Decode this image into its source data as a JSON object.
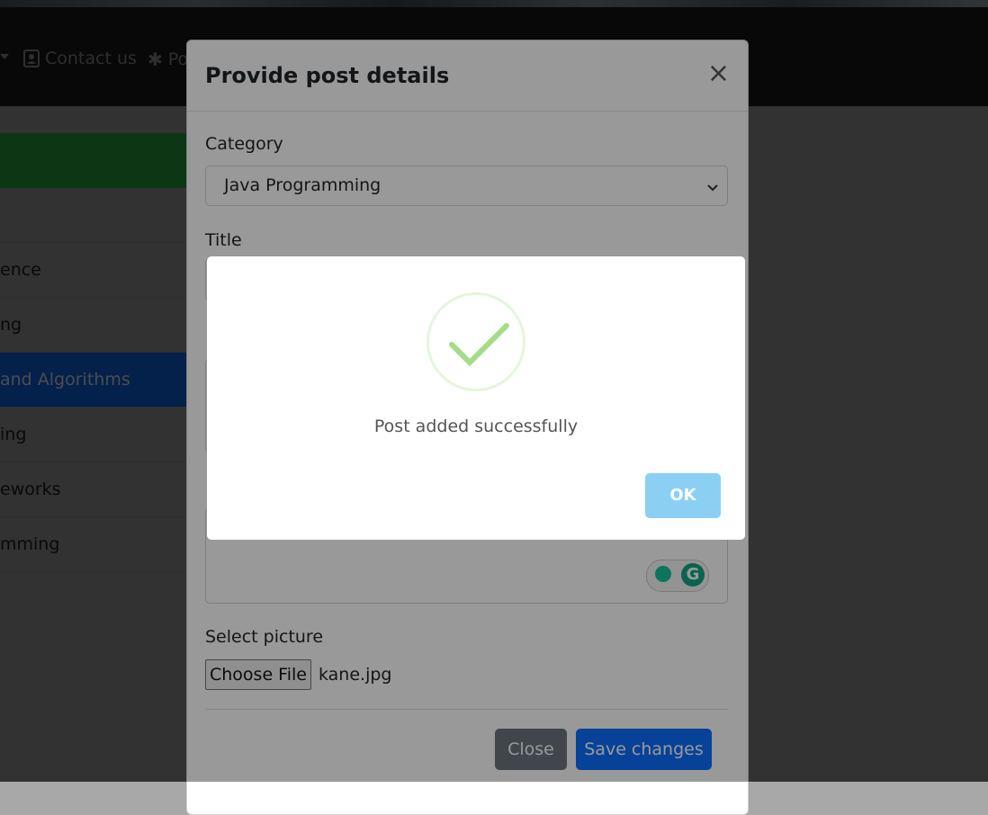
{
  "navbar": {
    "items": [
      {
        "label": "Contact us",
        "icon": "contact-card-icon"
      },
      {
        "label": "Po",
        "icon": "asterisk-icon"
      }
    ]
  },
  "sidebar": {
    "items": [
      {
        "label": "ence",
        "active": false
      },
      {
        "label": "ng",
        "active": false
      },
      {
        "label": "and Algorithms",
        "active": true
      },
      {
        "label": "ing",
        "active": false
      },
      {
        "label": "eworks",
        "active": false
      },
      {
        "label": "mming",
        "active": false
      }
    ]
  },
  "modal": {
    "title": "Provide post details",
    "close_icon": "×",
    "category_label": "Category",
    "category_value": "Java Programming",
    "title_label": "Title",
    "picture_label": "Select picture",
    "choose_file_label": "Choose File",
    "file_name": "kane.jpg",
    "close_button": "Close",
    "save_button": "Save changes"
  },
  "alert": {
    "message": "Post added successfully",
    "ok_label": "OK",
    "icon": "success-check-icon"
  },
  "colors": {
    "primary": "#0d6efd",
    "secondary": "#6c757d",
    "success_green": "#a5dc86",
    "ok_button": "#8bd0f4",
    "sidebar_header": "#2fb845"
  }
}
